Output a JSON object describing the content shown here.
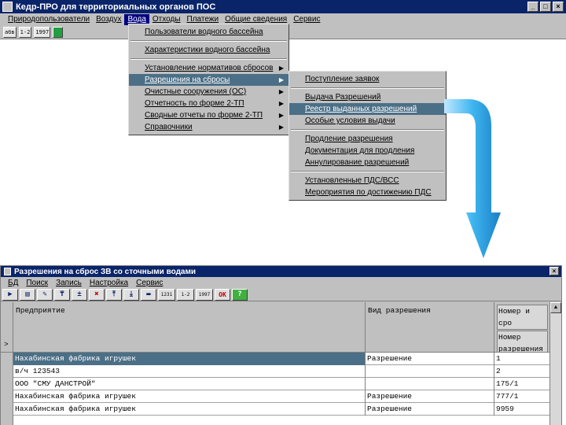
{
  "window": {
    "title": "Кедр-ПРО для территориальных органов ПОС"
  },
  "menubar": {
    "items": [
      "Природопользователи",
      "Воздух",
      "Вода",
      "Отходы",
      "Платежи",
      "Общие сведения",
      "Сервис"
    ],
    "active": "Вода"
  },
  "toolbar": {
    "buttons": [
      "абв",
      "1-2",
      "1997"
    ]
  },
  "water_menu": {
    "items": [
      "Пользователи водного бассейна",
      "Характеристики водного бассейна",
      "Установление нормативов сбросов",
      "Разрешения на сбросы",
      "Очистные сооружения (ОС)",
      "Отчетность по форме 2-ТП",
      "Сводные отчеты по форме 2-ТП",
      "Справочники"
    ]
  },
  "permits_submenu": {
    "items": [
      "Поступление заявок",
      "Выдача Разрешений",
      "Реестр выданных разрешений",
      "Особые условия выдачи",
      "Продление разрешения",
      "Документация для продления",
      "Аннулирование разрешений",
      "Установленные ПДС/ВСС",
      "Мероприятия по достижению ПДС"
    ]
  },
  "child": {
    "title": "Разрешения на сброс ЗВ со сточными водами",
    "menu": [
      "БД",
      "Поиск",
      "Запись",
      "Настройка",
      "Сервис"
    ],
    "tools": {
      "t1": "▶",
      "t2": "▤",
      "t3": "✎",
      "t4": "₸",
      "t5": "±",
      "t6": "✖",
      "t7": "⤒",
      "t8": "⤓",
      "t9": "▬",
      "t10": "1231",
      "t11": "1-2",
      "t12": "1997",
      "ok": "OK",
      "q": "?"
    },
    "columns": {
      "enterprise": "Предприятие",
      "permit_type": "Вид разрешения",
      "number_top": "Номер и сро",
      "number_sub": [
        "Номер",
        "разрешения"
      ]
    },
    "row_marker": ">",
    "rows": [
      {
        "enterprise": "Нахабинская фабрика игрушек",
        "type": "Разрешение",
        "number": "1"
      },
      {
        "enterprise": "в/ч 123543",
        "type": "",
        "number": "2"
      },
      {
        "enterprise": "ООО \"СМУ ДАНСТРОЙ\"",
        "type": "",
        "number": "175/1"
      },
      {
        "enterprise": "Нахабинская фабрика игрушек",
        "type": "Разрешение",
        "number": "777/1"
      },
      {
        "enterprise": "Нахабинская фабрика игрушек",
        "type": "Разрешение",
        "number": "9959"
      }
    ]
  },
  "colors": {
    "title_bar": "#0a246a",
    "selection": "#4b6f86",
    "arrow": "#3fb6f0",
    "chrome": "#c0c0c0"
  }
}
